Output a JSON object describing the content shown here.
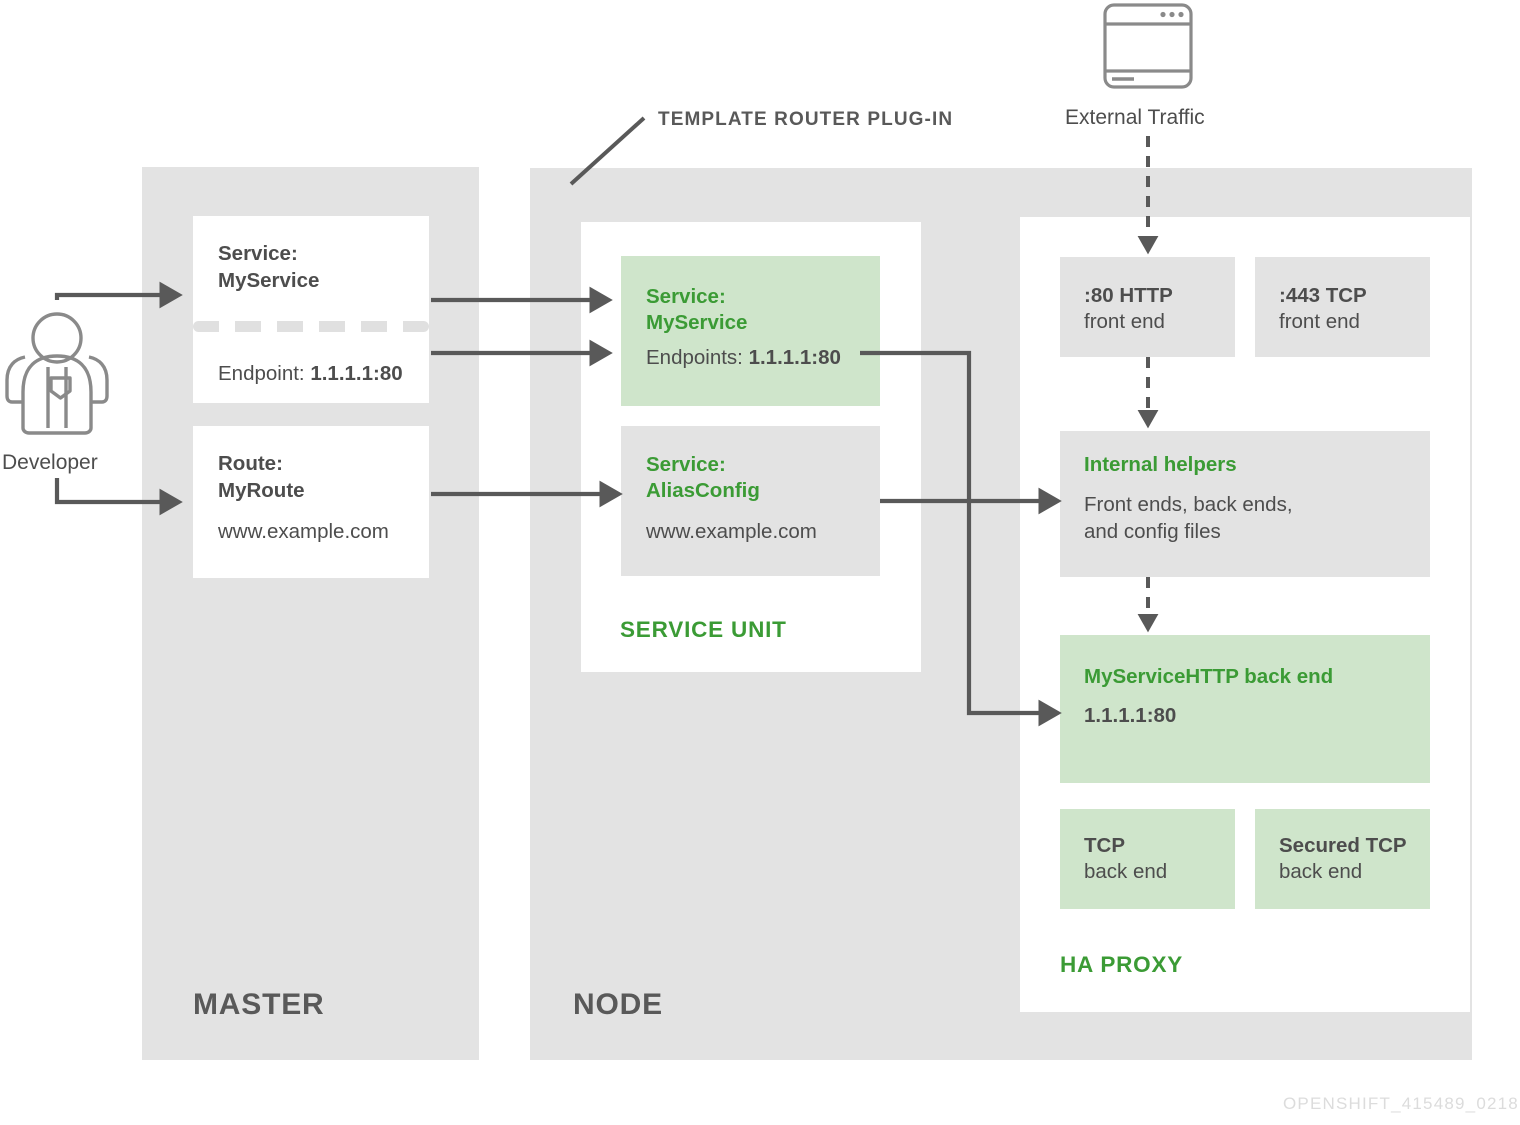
{
  "diagram": {
    "watermark": "OPENSHIFT_415489_0218",
    "colors": {
      "panel_gray": "#e3e3e3",
      "box_green": "#cfe5cb",
      "accent_green": "#3b9b35",
      "text_gray": "#4d4d4d",
      "label_gray": "#595959",
      "arrow_gray": "#595959",
      "watermark_gray": "#dcdcdc"
    },
    "labels": {
      "template_router_plugin": "TEMPLATE ROUTER PLUG-IN",
      "service_unit": "SERVICE UNIT",
      "ha_proxy": "HA PROXY",
      "master": "MASTER",
      "node": "NODE"
    },
    "actor": {
      "name": "Developer",
      "icon": "developer-person-icon"
    },
    "external": {
      "name": "External Traffic",
      "icon": "browser-window-icon"
    },
    "master": {
      "service_box": {
        "title_line1": "Service:",
        "title_line2": "MyService",
        "endpoint_label": "Endpoint: ",
        "endpoint_value": "1.1.1.1:80"
      },
      "route_box": {
        "title_line1": "Route:",
        "title_line2": "MyRoute",
        "host": "www.example.com"
      }
    },
    "service_unit": {
      "service_box": {
        "title_line1": "Service:",
        "title_line2": "MyService",
        "endpoints_label": "Endpoints: ",
        "endpoints_value": "1.1.1.1:80"
      },
      "alias_box": {
        "title_line1": "Service:",
        "title_line2": "AliasConfig",
        "host": "www.example.com"
      }
    },
    "haproxy": {
      "front_ends": [
        {
          "port": ":80 HTTP",
          "role": "front end"
        },
        {
          "port": ":443 TCP",
          "role": "front end"
        }
      ],
      "internal_helpers": {
        "title": "Internal helpers",
        "desc_line1": "Front ends, back ends,",
        "desc_line2": "and config files"
      },
      "http_back_end": {
        "title": "MyServiceHTTP back end",
        "address": "1.1.1.1:80"
      },
      "tcp_back_ends": [
        {
          "name": "TCP",
          "role": "back end"
        },
        {
          "name": "Secured TCP",
          "role": "back end"
        }
      ]
    }
  }
}
